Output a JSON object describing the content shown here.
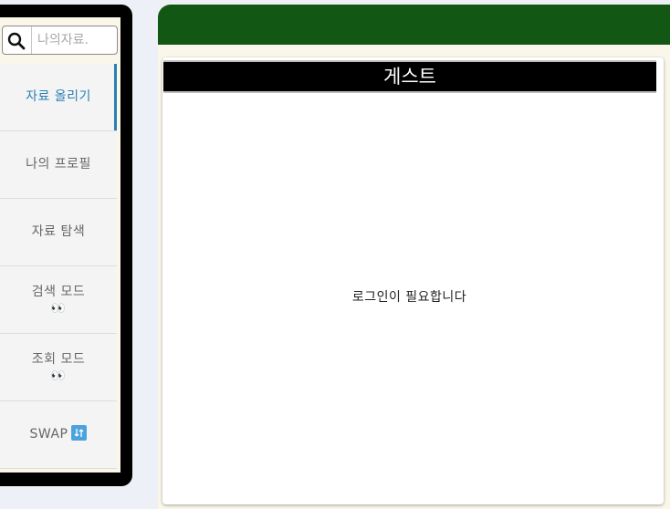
{
  "search": {
    "placeholder": "나의자료.",
    "value": ""
  },
  "menu": {
    "items": [
      {
        "label": "자료 올리기",
        "extra": "",
        "active": true
      },
      {
        "label": "나의 프로필",
        "extra": "",
        "active": false
      },
      {
        "label": "자료 탐색",
        "extra": "",
        "active": false
      },
      {
        "label": "검색 모드",
        "extra": "👀",
        "active": false
      },
      {
        "label": "조회 모드",
        "extra": "👀",
        "active": false
      },
      {
        "label": "SWAP",
        "extra": "🔃",
        "active": false
      }
    ]
  },
  "main": {
    "header_title": "게스트",
    "message": "로그인이 필요합니다"
  },
  "colors": {
    "top_bar": "#125714",
    "active_accent": "#2a7fb4",
    "sidebar_frame": "#000000"
  },
  "icons": {
    "search": "search-icon",
    "swap": "swap-icon",
    "eyes": "eyes-icon"
  }
}
